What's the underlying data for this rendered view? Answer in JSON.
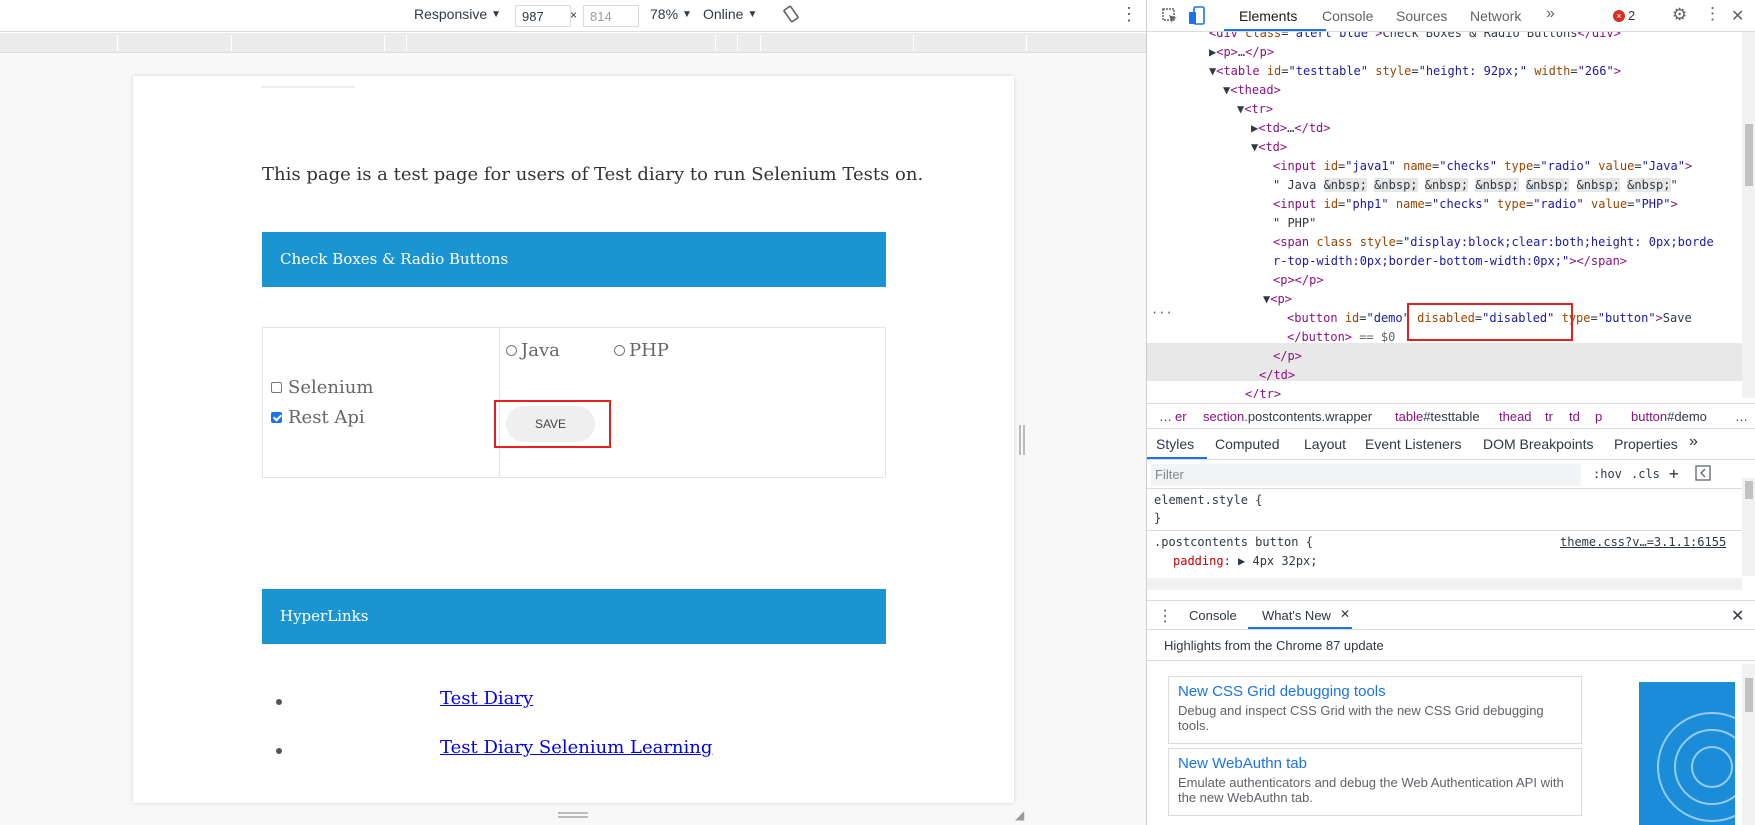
{
  "device_toolbar": {
    "mode": "Responsive",
    "width": "987",
    "height": "814",
    "zoom": "78%",
    "network": "Online"
  },
  "page": {
    "intro": "This page is a test page for users of Test diary to run Selenium Tests on.",
    "section1_title": "Check Boxes & Radio Buttons",
    "checkboxes": [
      {
        "label": "Selenium",
        "checked": false
      },
      {
        "label": "Rest Api",
        "checked": true
      }
    ],
    "radios": [
      {
        "label": "Java"
      },
      {
        "label": "PHP"
      }
    ],
    "save_label": "SAVE",
    "section2_title": "HyperLinks",
    "links": [
      "Test Diary",
      "Test Diary Selenium Learning"
    ]
  },
  "devtools": {
    "tabs": [
      "Elements",
      "Console",
      "Sources",
      "Network"
    ],
    "error_count": "2",
    "breadcrumbs": [
      {
        "tag": "er",
        "rest": ""
      },
      {
        "tag": "section",
        "rest": ".postcontents.wrapper"
      },
      {
        "tag": "table",
        "rest": "#testtable"
      },
      {
        "tag": "thead",
        "rest": ""
      },
      {
        "tag": "tr",
        "rest": ""
      },
      {
        "tag": "td",
        "rest": ""
      },
      {
        "tag": "p",
        "rest": ""
      },
      {
        "tag": "button",
        "rest": "#demo"
      }
    ],
    "styles_tabs": [
      "Styles",
      "Computed",
      "Layout",
      "Event Listeners",
      "DOM Breakpoints",
      "Properties"
    ],
    "filter_placeholder": "Filter",
    "hov": ":hov",
    "cls": ".cls",
    "element_style": "element.style {",
    "close_brace": "}",
    "rule_selector": ".postcontents button {",
    "rule_source": "theme.css?v…=3.1.1:6155",
    "rule_prop": "padding",
    "rule_value": "4px 32px;",
    "drawer_tabs": [
      "Console",
      "What's New"
    ],
    "highlights": "Highlights from the Chrome 87 update",
    "cards": [
      {
        "title": "New CSS Grid debugging tools",
        "desc": "Debug and inspect CSS Grid with the new CSS Grid debugging tools."
      },
      {
        "title": "New WebAuthn tab",
        "desc": "Emulate authenticators and debug the Web Authentication API with the new WebAuthn tab."
      }
    ]
  },
  "colors": {
    "accent": "#1b95d1",
    "highlight": "#e5211f",
    "link": "#0000ee"
  }
}
